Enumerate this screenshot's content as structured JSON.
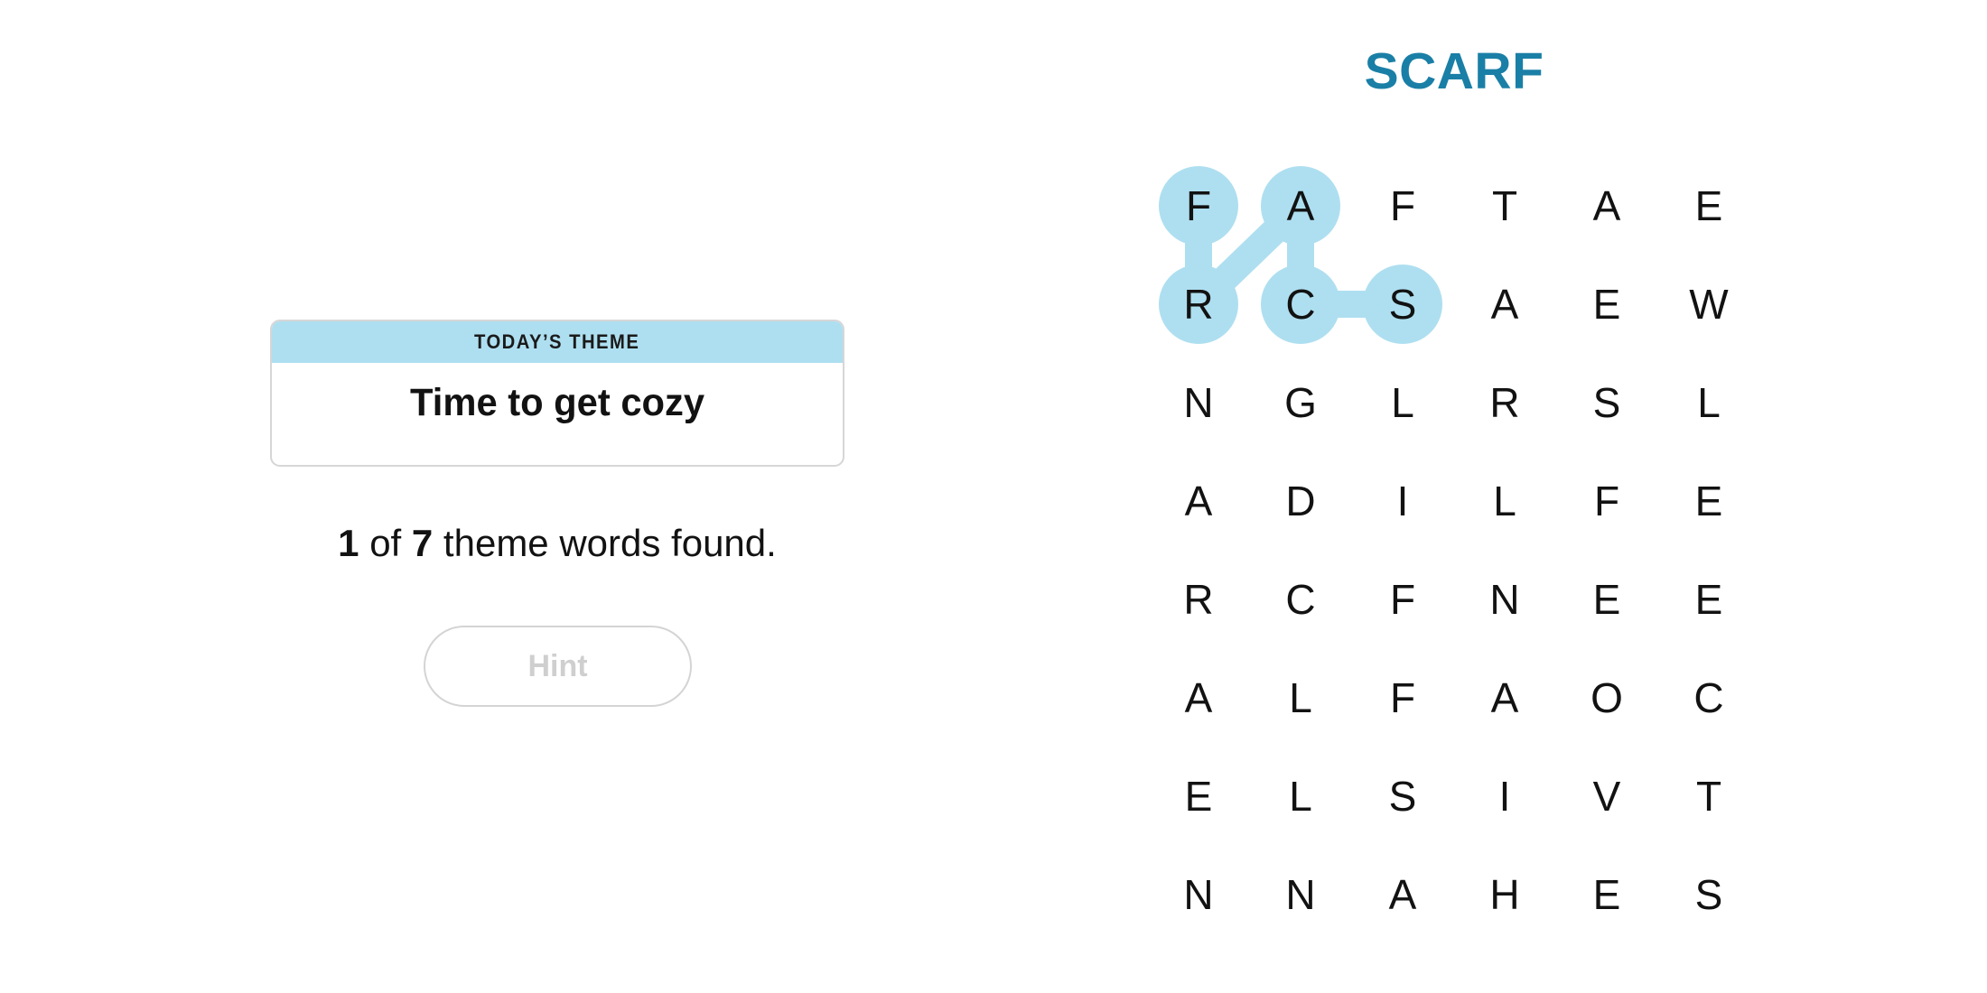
{
  "theme": {
    "label": "TODAY’S THEME",
    "title": "Time to get cozy"
  },
  "progress": {
    "found": "1",
    "of_text": " of ",
    "total": "7",
    "suffix": " theme words found."
  },
  "hint_button": {
    "label": "Hint",
    "enabled": false
  },
  "current_word": "SCARF",
  "colors": {
    "highlight": "#aedff0",
    "current_word": "#1a7fa6",
    "hint_disabled_text": "#cfcfcf"
  },
  "board": {
    "rows": 8,
    "cols": 6,
    "letters": [
      [
        "F",
        "A",
        "F",
        "T",
        "A",
        "E"
      ],
      [
        "R",
        "C",
        "S",
        "A",
        "E",
        "W"
      ],
      [
        "N",
        "G",
        "L",
        "R",
        "S",
        "L"
      ],
      [
        "A",
        "D",
        "I",
        "L",
        "F",
        "E"
      ],
      [
        "R",
        "C",
        "F",
        "N",
        "E",
        "E"
      ],
      [
        "A",
        "L",
        "F",
        "A",
        "O",
        "C"
      ],
      [
        "E",
        "L",
        "S",
        "I",
        "V",
        "T"
      ],
      [
        "N",
        "N",
        "A",
        "H",
        "E",
        "S"
      ]
    ],
    "selected_path": [
      {
        "row": 1,
        "col": 2,
        "letter": "S"
      },
      {
        "row": 1,
        "col": 1,
        "letter": "C"
      },
      {
        "row": 0,
        "col": 1,
        "letter": "A"
      },
      {
        "row": 1,
        "col": 0,
        "letter": "R"
      },
      {
        "row": 0,
        "col": 0,
        "letter": "F"
      }
    ]
  }
}
